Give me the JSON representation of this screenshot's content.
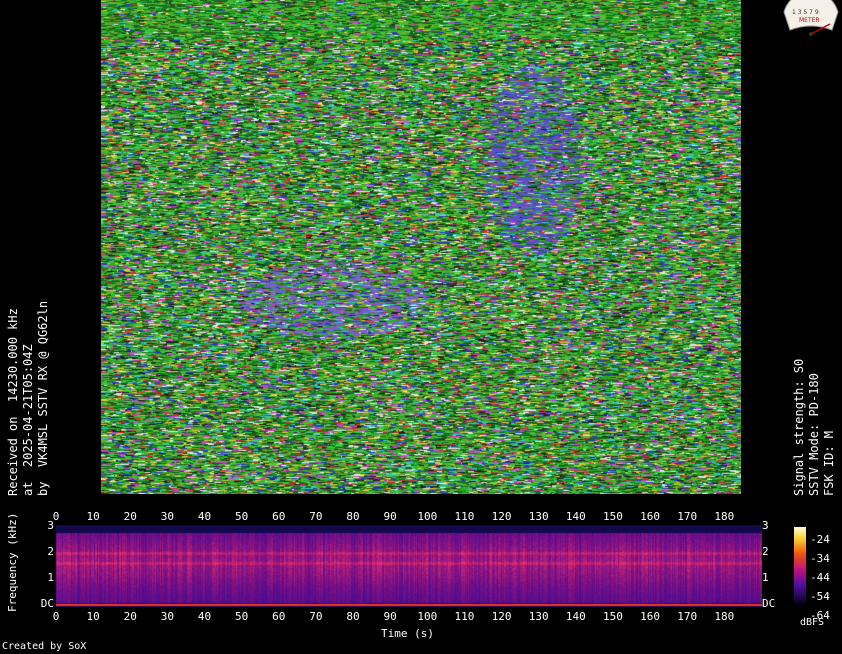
{
  "caption_left": {
    "line1": "Received on  14230.000 kHz",
    "line2": "at  2025-04-21T05:04Z",
    "line3": "by  VK4MSL SSTV RX @ QG62ln"
  },
  "caption_right": {
    "line1": "Signal strength: S0",
    "line2": "SSTV Mode: PD-180",
    "line3": "FSK ID: M"
  },
  "meter_logo": {
    "scale_text": "1 3 5 7 9",
    "word": "METER"
  },
  "spectrogram": {
    "x_ticks": [
      "0",
      "10",
      "20",
      "30",
      "40",
      "50",
      "60",
      "70",
      "80",
      "90",
      "100",
      "110",
      "120",
      "130",
      "140",
      "150",
      "160",
      "170",
      "180"
    ],
    "y_ticks": [
      "3",
      "2",
      "1",
      "DC"
    ],
    "x_axis_label": "Time (s)",
    "y_axis_label": "Frequency (kHz)",
    "colorbar_ticks": [
      "-24",
      "-34",
      "-44",
      "-54",
      "-64"
    ],
    "colorbar_unit": "dBFS"
  },
  "credit": "Created by SoX",
  "colors": {
    "background": "#000000",
    "spectrogram_base": "#2a0a6a",
    "spectrogram_hot": "#c83060",
    "dc_line": "#ff3030",
    "image_dominant": "#30b030"
  }
}
